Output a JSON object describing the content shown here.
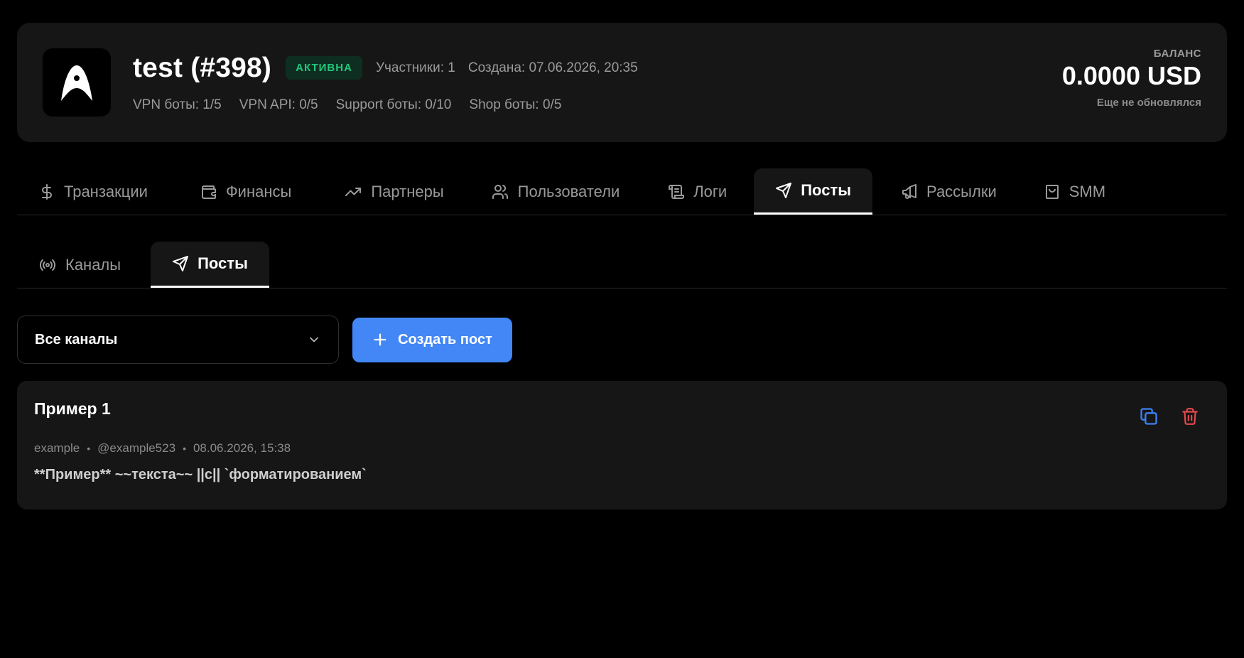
{
  "header": {
    "title": "test (#398)",
    "status": "АКТИВНА",
    "participants": "Участники: 1",
    "created": "Создана: 07.06.2026, 20:35",
    "limits": [
      "VPN боты: 1/5",
      "VPN API: 0/5",
      "Support боты: 0/10",
      "Shop боты: 0/5"
    ],
    "balance_label": "БАЛАНС",
    "balance_value": "0.0000 USD",
    "balance_note": "Еще не обновлялся"
  },
  "main_tabs": [
    {
      "label": "Транзакции",
      "icon": "dollar-icon"
    },
    {
      "label": "Финансы",
      "icon": "wallet-icon"
    },
    {
      "label": "Партнеры",
      "icon": "trending-up-icon"
    },
    {
      "label": "Пользователи",
      "icon": "users-icon"
    },
    {
      "label": "Логи",
      "icon": "scroll-icon"
    },
    {
      "label": "Посты",
      "icon": "send-icon",
      "active": true
    },
    {
      "label": "Рассылки",
      "icon": "megaphone-icon"
    },
    {
      "label": "SMM",
      "icon": "shopping-bag-icon"
    }
  ],
  "sub_tabs": [
    {
      "label": "Каналы",
      "icon": "radio-icon"
    },
    {
      "label": "Посты",
      "icon": "send-icon",
      "active": true
    }
  ],
  "controls": {
    "channel_select_value": "Все каналы",
    "create_button": "Создать пост"
  },
  "posts": [
    {
      "title": "Пример 1",
      "channel": "example",
      "username": "@example523",
      "date": "08.06.2026, 15:38",
      "body": "**Пример** ~~текста~~ ||с|| `форматированием`"
    }
  ],
  "colors": {
    "accent": "#4287f5",
    "status_green": "#22c77a",
    "delete_red": "#e5484d",
    "copy_blue": "#3b82f6",
    "card_bg": "#161616"
  }
}
